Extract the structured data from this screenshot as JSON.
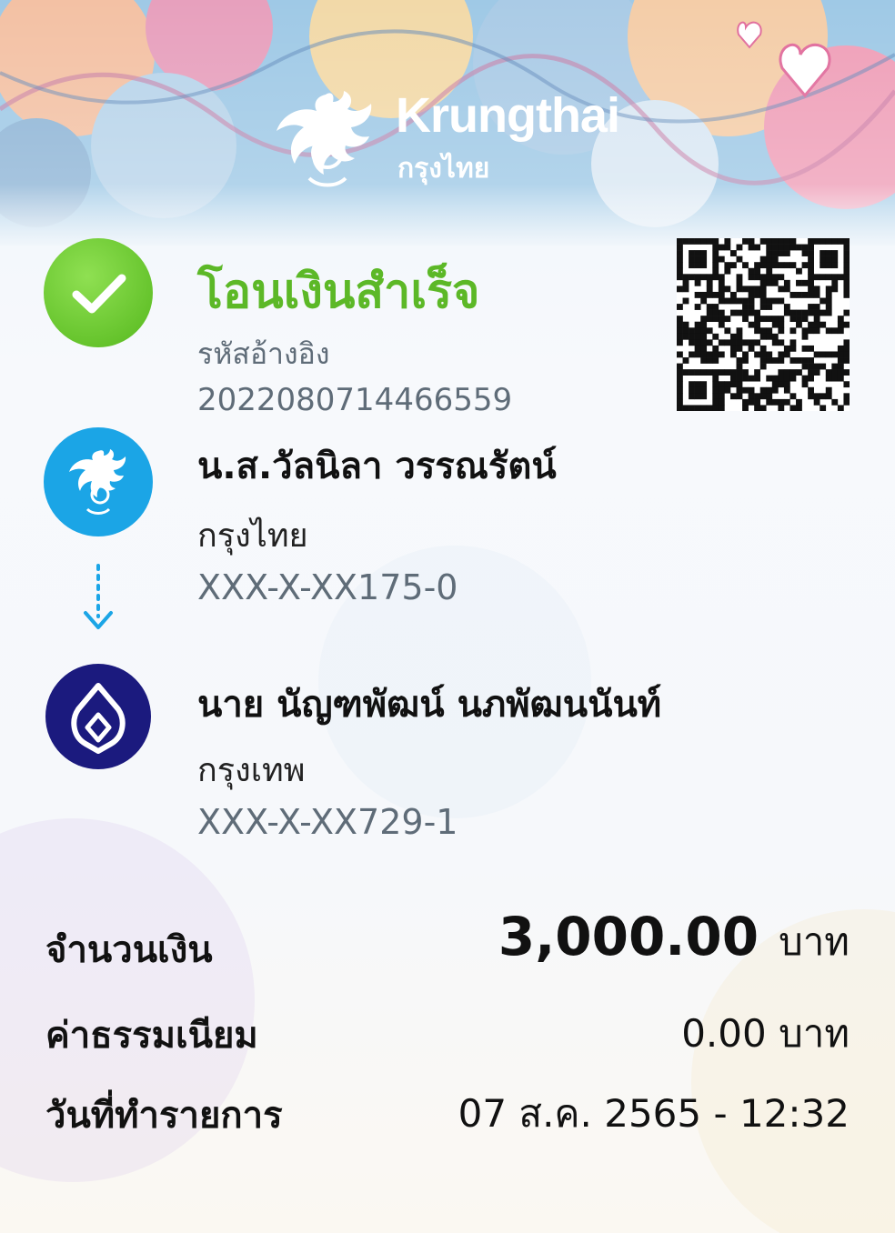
{
  "brand": {
    "name_en": "Krungthai",
    "name_th": "กรุงไทย"
  },
  "status": {
    "title": "โอนเงินสำเร็จ",
    "ref_label": "รหัสอ้างอิง",
    "ref_value": "2022080714466559",
    "icon": "check-icon",
    "color": "#5cb827"
  },
  "sender": {
    "name": "น.ส.วัลนิลา วรรณรัตน์",
    "bank": "กรุงไทย",
    "account": "XXX-X-XX175-0",
    "icon": "krungthai-logo-icon",
    "color": "#1ba5e6"
  },
  "transfer_arrow_icon": "arrow-down-icon",
  "receiver": {
    "name": "นาย นัญฑพัฒน์ นภพัฒนนันท์",
    "bank": "กรุงเทพ",
    "account": "XXX-X-XX729-1",
    "icon": "bangkok-bank-logo-icon",
    "color": "#1b1a7e"
  },
  "summary": {
    "amount_label": "จำนวนเงิน",
    "amount_value": "3,000.00",
    "amount_unit": "บาท",
    "fee_label": "ค่าธรรมเนียม",
    "fee_value": "0.00 บาท",
    "date_label": "วันที่ทำรายการ",
    "date_value": "07 ส.ค. 2565 - 12:32"
  }
}
